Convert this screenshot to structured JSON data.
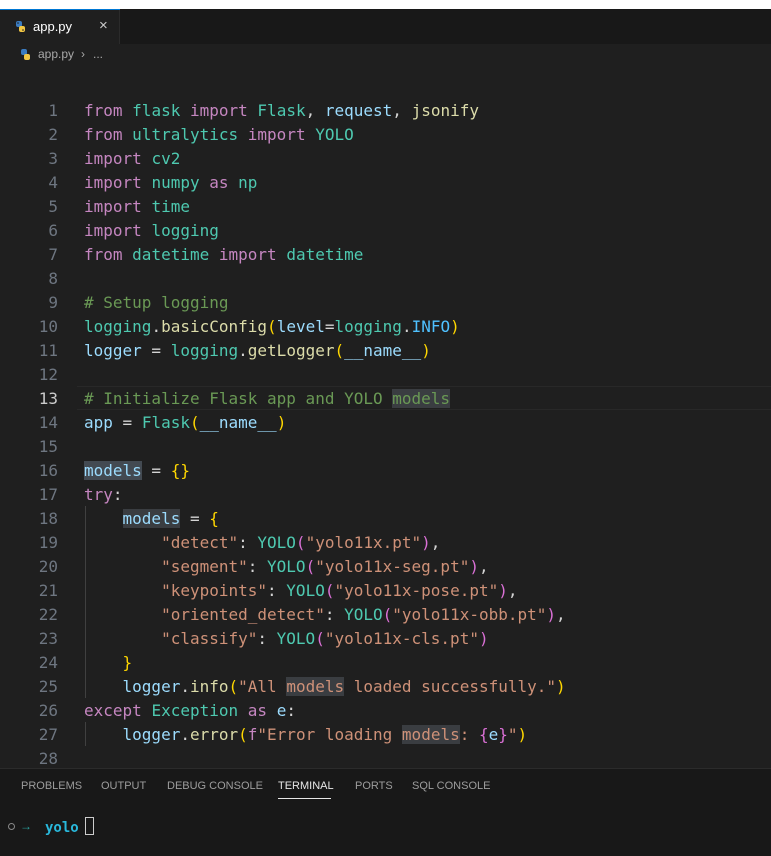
{
  "tab": {
    "label": "app.py",
    "close": "×"
  },
  "breadcrumb": {
    "file": "app.py",
    "separator": "›",
    "ellipsis": "..."
  },
  "icons": {
    "file": "python-icon",
    "close": "close-icon"
  },
  "editor": {
    "active_line": 13,
    "lines": [
      {
        "n": "1",
        "tokens": [
          [
            "kw",
            "from"
          ],
          [
            "op",
            " "
          ],
          [
            "mod",
            "flask"
          ],
          [
            "op",
            " "
          ],
          [
            "kw",
            "import"
          ],
          [
            "op",
            " "
          ],
          [
            "cls",
            "Flask"
          ],
          [
            "op",
            ", "
          ],
          [
            "var",
            "request"
          ],
          [
            "op",
            ", "
          ],
          [
            "fn",
            "jsonify"
          ]
        ]
      },
      {
        "n": "2",
        "tokens": [
          [
            "kw",
            "from"
          ],
          [
            "op",
            " "
          ],
          [
            "mod",
            "ultralytics"
          ],
          [
            "op",
            " "
          ],
          [
            "kw",
            "import"
          ],
          [
            "op",
            " "
          ],
          [
            "cls",
            "YOLO"
          ]
        ]
      },
      {
        "n": "3",
        "tokens": [
          [
            "kw",
            "import"
          ],
          [
            "op",
            " "
          ],
          [
            "mod",
            "cv2"
          ]
        ]
      },
      {
        "n": "4",
        "tokens": [
          [
            "kw",
            "import"
          ],
          [
            "op",
            " "
          ],
          [
            "mod",
            "numpy"
          ],
          [
            "op",
            " "
          ],
          [
            "kw",
            "as"
          ],
          [
            "op",
            " "
          ],
          [
            "mod",
            "np"
          ]
        ]
      },
      {
        "n": "5",
        "tokens": [
          [
            "kw",
            "import"
          ],
          [
            "op",
            " "
          ],
          [
            "mod",
            "time"
          ]
        ]
      },
      {
        "n": "6",
        "tokens": [
          [
            "kw",
            "import"
          ],
          [
            "op",
            " "
          ],
          [
            "mod",
            "logging"
          ]
        ]
      },
      {
        "n": "7",
        "tokens": [
          [
            "kw",
            "from"
          ],
          [
            "op",
            " "
          ],
          [
            "mod",
            "datetime"
          ],
          [
            "op",
            " "
          ],
          [
            "kw",
            "import"
          ],
          [
            "op",
            " "
          ],
          [
            "cls",
            "datetime"
          ]
        ]
      },
      {
        "n": "8",
        "tokens": []
      },
      {
        "n": "9",
        "tokens": [
          [
            "cmt",
            "# Setup logging"
          ]
        ]
      },
      {
        "n": "10",
        "tokens": [
          [
            "mod",
            "logging"
          ],
          [
            "op",
            "."
          ],
          [
            "fn",
            "basicConfig"
          ],
          [
            "p1",
            "("
          ],
          [
            "var",
            "level"
          ],
          [
            "op",
            "="
          ],
          [
            "mod",
            "logging"
          ],
          [
            "op",
            "."
          ],
          [
            "cst",
            "INFO"
          ],
          [
            "p1",
            ")"
          ]
        ]
      },
      {
        "n": "11",
        "tokens": [
          [
            "var",
            "logger"
          ],
          [
            "op",
            " = "
          ],
          [
            "mod",
            "logging"
          ],
          [
            "op",
            "."
          ],
          [
            "fn",
            "getLogger"
          ],
          [
            "p1",
            "("
          ],
          [
            "var",
            "__name__"
          ],
          [
            "p1",
            ")"
          ]
        ]
      },
      {
        "n": "12",
        "tokens": []
      },
      {
        "n": "13",
        "tokens": [
          [
            "cmt",
            "# Initialize Flask app and YOLO "
          ],
          [
            "cmt hl",
            "models"
          ]
        ]
      },
      {
        "n": "14",
        "tokens": [
          [
            "var",
            "app"
          ],
          [
            "op",
            " = "
          ],
          [
            "cls",
            "Flask"
          ],
          [
            "p1",
            "("
          ],
          [
            "var",
            "__name__"
          ],
          [
            "p1",
            ")"
          ]
        ]
      },
      {
        "n": "15",
        "tokens": []
      },
      {
        "n": "16",
        "tokens": [
          [
            "var hl2",
            "models"
          ],
          [
            "op",
            " = "
          ],
          [
            "p1",
            "{}"
          ]
        ]
      },
      {
        "n": "17",
        "tokens": [
          [
            "kw",
            "try"
          ],
          [
            "op",
            ":"
          ]
        ]
      },
      {
        "n": "18",
        "tokens": [
          [
            "op",
            "    "
          ],
          [
            "var hl",
            "models"
          ],
          [
            "op",
            " = "
          ],
          [
            "p1",
            "{"
          ]
        ]
      },
      {
        "n": "19",
        "tokens": [
          [
            "op",
            "        "
          ],
          [
            "str",
            "\"detect\""
          ],
          [
            "op",
            ": "
          ],
          [
            "cls",
            "YOLO"
          ],
          [
            "p2",
            "("
          ],
          [
            "str",
            "\"yolo11x.pt\""
          ],
          [
            "p2",
            ")"
          ],
          [
            "op",
            ","
          ]
        ]
      },
      {
        "n": "20",
        "tokens": [
          [
            "op",
            "        "
          ],
          [
            "str",
            "\"segment\""
          ],
          [
            "op",
            ": "
          ],
          [
            "cls",
            "YOLO"
          ],
          [
            "p2",
            "("
          ],
          [
            "str",
            "\"yolo11x-seg.pt\""
          ],
          [
            "p2",
            ")"
          ],
          [
            "op",
            ","
          ]
        ]
      },
      {
        "n": "21",
        "tokens": [
          [
            "op",
            "        "
          ],
          [
            "str",
            "\"keypoints\""
          ],
          [
            "op",
            ": "
          ],
          [
            "cls",
            "YOLO"
          ],
          [
            "p2",
            "("
          ],
          [
            "str",
            "\"yolo11x-pose.pt\""
          ],
          [
            "p2",
            ")"
          ],
          [
            "op",
            ","
          ]
        ]
      },
      {
        "n": "22",
        "tokens": [
          [
            "op",
            "        "
          ],
          [
            "str",
            "\"oriented_detect\""
          ],
          [
            "op",
            ": "
          ],
          [
            "cls",
            "YOLO"
          ],
          [
            "p2",
            "("
          ],
          [
            "str",
            "\"yolo11x-obb.pt\""
          ],
          [
            "p2",
            ")"
          ],
          [
            "op",
            ","
          ]
        ]
      },
      {
        "n": "23",
        "tokens": [
          [
            "op",
            "        "
          ],
          [
            "str",
            "\"classify\""
          ],
          [
            "op",
            ": "
          ],
          [
            "cls",
            "YOLO"
          ],
          [
            "p2",
            "("
          ],
          [
            "str",
            "\"yolo11x-cls.pt\""
          ],
          [
            "p2",
            ")"
          ]
        ]
      },
      {
        "n": "24",
        "tokens": [
          [
            "op",
            "    "
          ],
          [
            "p1",
            "}"
          ]
        ]
      },
      {
        "n": "25",
        "tokens": [
          [
            "op",
            "    "
          ],
          [
            "var",
            "logger"
          ],
          [
            "op",
            "."
          ],
          [
            "fn",
            "info"
          ],
          [
            "p1",
            "("
          ],
          [
            "str",
            "\"All "
          ],
          [
            "str hl",
            "models"
          ],
          [
            "str",
            " loaded successfully.\""
          ],
          [
            "p1",
            ")"
          ]
        ]
      },
      {
        "n": "26",
        "tokens": [
          [
            "kw",
            "except"
          ],
          [
            "op",
            " "
          ],
          [
            "cls",
            "Exception"
          ],
          [
            "op",
            " "
          ],
          [
            "kw",
            "as"
          ],
          [
            "op",
            " "
          ],
          [
            "var",
            "e"
          ],
          [
            "op",
            ":"
          ]
        ]
      },
      {
        "n": "27",
        "tokens": [
          [
            "op",
            "    "
          ],
          [
            "var",
            "logger"
          ],
          [
            "op",
            "."
          ],
          [
            "fn",
            "error"
          ],
          [
            "p1",
            "("
          ],
          [
            "kw",
            "f"
          ],
          [
            "str",
            "\"Error loading "
          ],
          [
            "str hl",
            "models"
          ],
          [
            "str",
            ": "
          ],
          [
            "p2",
            "{"
          ],
          [
            "var",
            "e"
          ],
          [
            "p2",
            "}"
          ],
          [
            "str",
            "\""
          ],
          [
            "p1",
            ")"
          ]
        ]
      },
      {
        "n": "28",
        "tokens": []
      }
    ]
  },
  "panel": {
    "tabs": [
      "PROBLEMS",
      "OUTPUT",
      "DEBUG CONSOLE",
      "TERMINAL",
      "PORTS",
      "SQL CONSOLE"
    ],
    "active_tab": "TERMINAL"
  },
  "terminal": {
    "arrow": "→",
    "prompt_dir": "yolo"
  }
}
